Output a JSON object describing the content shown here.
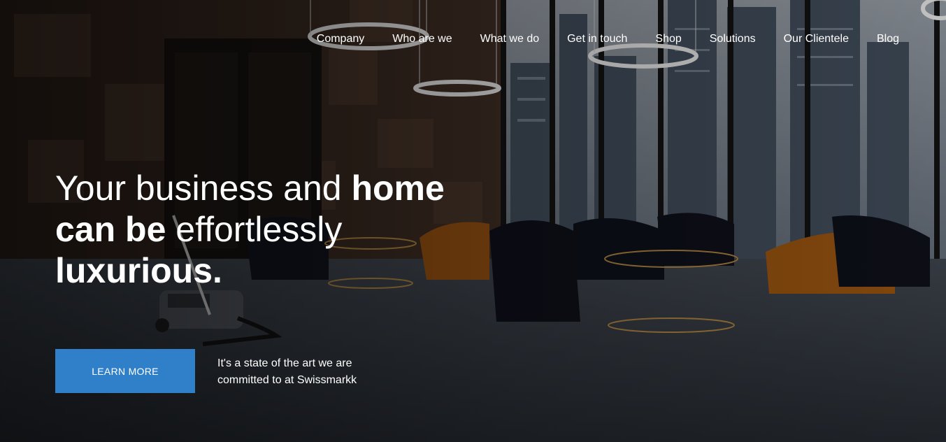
{
  "nav": {
    "items": [
      {
        "label": "Company"
      },
      {
        "label": "Who are we"
      },
      {
        "label": "What we do"
      },
      {
        "label": "Get in touch"
      },
      {
        "label": "Shop"
      },
      {
        "label": "Solutions"
      },
      {
        "label": "Our Clientele"
      },
      {
        "label": "Blog"
      }
    ]
  },
  "hero": {
    "headline": {
      "part1": "Your business and ",
      "part2_bold": "home",
      "part3_bold": "can be",
      "part4": " effortlessly ",
      "part5_bold": "luxurious."
    },
    "cta_label": "LEARN MORE",
    "tagline": "It's a state of the art we are committed to at Swissmarkk"
  },
  "colors": {
    "cta_background": "#2f80c8",
    "text": "#ffffff"
  }
}
